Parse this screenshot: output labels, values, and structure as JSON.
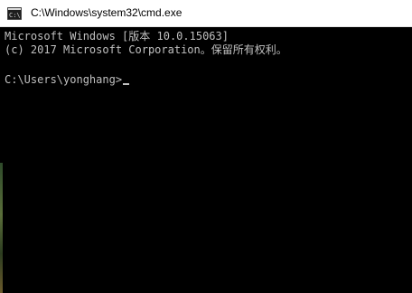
{
  "window": {
    "title": "C:\\Windows\\system32\\cmd.exe",
    "icon": "cmd-console-icon"
  },
  "console": {
    "lines": [
      "Microsoft Windows [版本 10.0.15063]",
      "(c) 2017 Microsoft Corporation。保留所有权利。"
    ],
    "prompt": "C:\\Users\\yonghang>"
  },
  "colors": {
    "console_bg": "#000000",
    "console_text": "#c0c0c0",
    "titlebar_bg": "#ffffff"
  }
}
